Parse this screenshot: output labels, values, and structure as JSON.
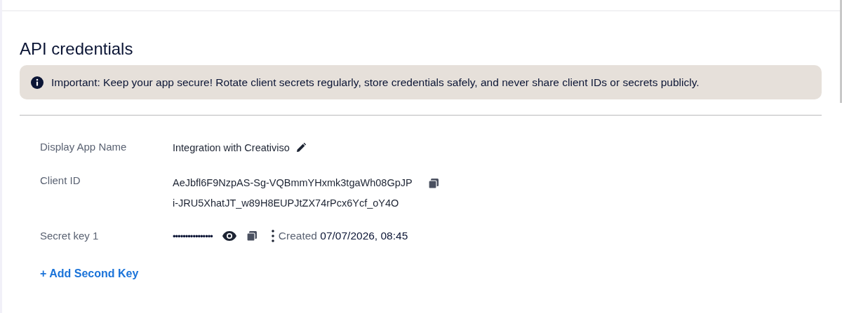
{
  "section": {
    "title": "API credentials"
  },
  "notice": {
    "text": "Important: Keep your app secure! Rotate client secrets regularly, store credentials safely, and never share client IDs or secrets publicly."
  },
  "fields": [
    {
      "kind": "name",
      "label": "Display App Name",
      "value": "Integration with Creativiso"
    },
    {
      "kind": "id",
      "label": "Client ID",
      "lines": [
        "AeJbfl6F9NzpAS-Sg-VQBmmYHxmk3tgaWh08GpJP",
        "i-JRU5XhatJT_w89H8EUPJtZX74rPcx6Ycf_oY4O"
      ]
    },
    {
      "kind": "secret",
      "label": "Secret key 1",
      "value": "••••••••••••••••",
      "created_label": "Created",
      "created": "07/07/2026, 08:45"
    }
  ],
  "add_button": "+ Add Second Key"
}
